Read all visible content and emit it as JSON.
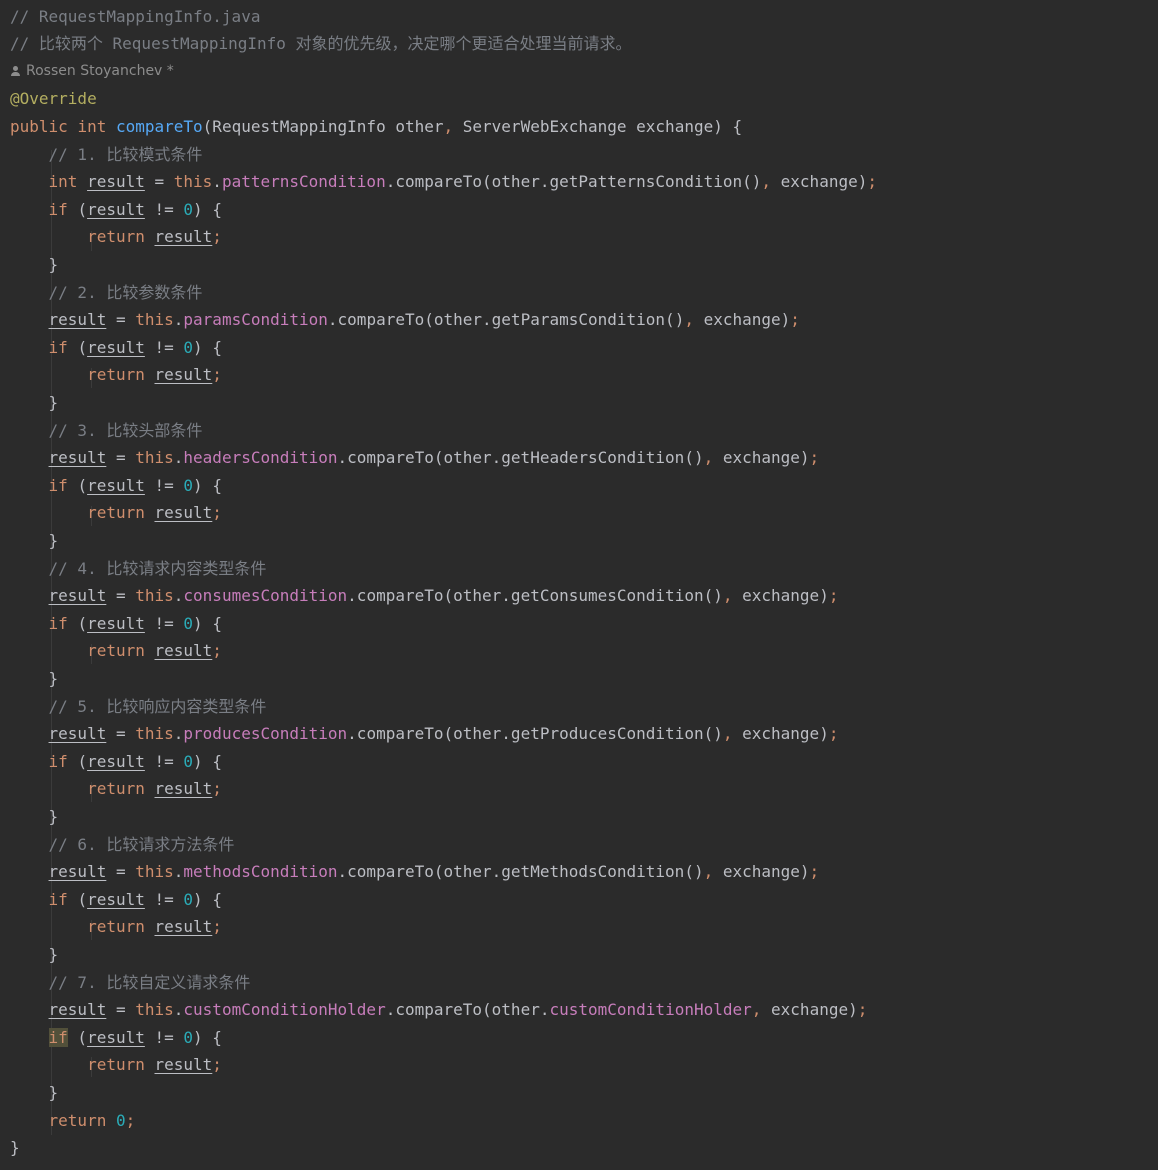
{
  "editor": {
    "author": {
      "icon": "user-icon",
      "text": "Rossen Stoyanchev *"
    },
    "lines": [
      [
        [
          "comment",
          "// RequestMappingInfo.java"
        ]
      ],
      [
        [
          "comment",
          "// 比较两个 RequestMappingInfo 对象的优先级，决定哪个更适合处理当前请求。"
        ]
      ],
      [],
      [
        [
          "annotation",
          "@Override"
        ]
      ],
      [
        [
          "keyword",
          "public "
        ],
        [
          "keyword",
          "int "
        ],
        [
          "method",
          "compareTo"
        ],
        [
          "plain",
          "(RequestMappingInfo other"
        ],
        [
          "punct",
          ", "
        ],
        [
          "plain",
          "ServerWebExchange exchange) {"
        ]
      ],
      [
        [
          "plain",
          "    "
        ],
        [
          "comment",
          "// 1. 比较模式条件"
        ]
      ],
      [
        [
          "plain",
          "    "
        ],
        [
          "keyword",
          "int "
        ],
        [
          "local",
          "result"
        ],
        [
          "plain",
          " = "
        ],
        [
          "keyword",
          "this"
        ],
        [
          "plain",
          "."
        ],
        [
          "field",
          "patternsCondition"
        ],
        [
          "plain",
          ".compareTo(other.getPatternsCondition()"
        ],
        [
          "punct",
          ", "
        ],
        [
          "plain",
          "exchange)"
        ],
        [
          "punct",
          ";"
        ]
      ],
      [
        [
          "plain",
          "    "
        ],
        [
          "keyword",
          "if "
        ],
        [
          "plain",
          "("
        ],
        [
          "local",
          "result"
        ],
        [
          "plain",
          " != "
        ],
        [
          "number",
          "0"
        ],
        [
          "plain",
          ") {"
        ]
      ],
      [
        [
          "plain",
          "        "
        ],
        [
          "keyword",
          "return "
        ],
        [
          "local",
          "result"
        ],
        [
          "punct",
          ";"
        ]
      ],
      [
        [
          "plain",
          "    }"
        ]
      ],
      [
        [
          "plain",
          "    "
        ],
        [
          "comment",
          "// 2. 比较参数条件"
        ]
      ],
      [
        [
          "plain",
          "    "
        ],
        [
          "local",
          "result"
        ],
        [
          "plain",
          " = "
        ],
        [
          "keyword",
          "this"
        ],
        [
          "plain",
          "."
        ],
        [
          "field",
          "paramsCondition"
        ],
        [
          "plain",
          ".compareTo(other.getParamsCondition()"
        ],
        [
          "punct",
          ", "
        ],
        [
          "plain",
          "exchange)"
        ],
        [
          "punct",
          ";"
        ]
      ],
      [
        [
          "plain",
          "    "
        ],
        [
          "keyword",
          "if "
        ],
        [
          "plain",
          "("
        ],
        [
          "local",
          "result"
        ],
        [
          "plain",
          " != "
        ],
        [
          "number",
          "0"
        ],
        [
          "plain",
          ") {"
        ]
      ],
      [
        [
          "plain",
          "        "
        ],
        [
          "keyword",
          "return "
        ],
        [
          "local",
          "result"
        ],
        [
          "punct",
          ";"
        ]
      ],
      [
        [
          "plain",
          "    }"
        ]
      ],
      [
        [
          "plain",
          "    "
        ],
        [
          "comment",
          "// 3. 比较头部条件"
        ]
      ],
      [
        [
          "plain",
          "    "
        ],
        [
          "local",
          "result"
        ],
        [
          "plain",
          " = "
        ],
        [
          "keyword",
          "this"
        ],
        [
          "plain",
          "."
        ],
        [
          "field",
          "headersCondition"
        ],
        [
          "plain",
          ".compareTo(other.getHeadersCondition()"
        ],
        [
          "punct",
          ", "
        ],
        [
          "plain",
          "exchange)"
        ],
        [
          "punct",
          ";"
        ]
      ],
      [
        [
          "plain",
          "    "
        ],
        [
          "keyword",
          "if "
        ],
        [
          "plain",
          "("
        ],
        [
          "local",
          "result"
        ],
        [
          "plain",
          " != "
        ],
        [
          "number",
          "0"
        ],
        [
          "plain",
          ") {"
        ]
      ],
      [
        [
          "plain",
          "        "
        ],
        [
          "keyword",
          "return "
        ],
        [
          "local",
          "result"
        ],
        [
          "punct",
          ";"
        ]
      ],
      [
        [
          "plain",
          "    }"
        ]
      ],
      [
        [
          "plain",
          "    "
        ],
        [
          "comment",
          "// 4. 比较请求内容类型条件"
        ]
      ],
      [
        [
          "plain",
          "    "
        ],
        [
          "local",
          "result"
        ],
        [
          "plain",
          " = "
        ],
        [
          "keyword",
          "this"
        ],
        [
          "plain",
          "."
        ],
        [
          "field",
          "consumesCondition"
        ],
        [
          "plain",
          ".compareTo(other.getConsumesCondition()"
        ],
        [
          "punct",
          ", "
        ],
        [
          "plain",
          "exchange)"
        ],
        [
          "punct",
          ";"
        ]
      ],
      [
        [
          "plain",
          "    "
        ],
        [
          "keyword",
          "if "
        ],
        [
          "plain",
          "("
        ],
        [
          "local",
          "result"
        ],
        [
          "plain",
          " != "
        ],
        [
          "number",
          "0"
        ],
        [
          "plain",
          ") {"
        ]
      ],
      [
        [
          "plain",
          "        "
        ],
        [
          "keyword",
          "return "
        ],
        [
          "local",
          "result"
        ],
        [
          "punct",
          ";"
        ]
      ],
      [
        [
          "plain",
          "    }"
        ]
      ],
      [
        [
          "plain",
          "    "
        ],
        [
          "comment",
          "// 5. 比较响应内容类型条件"
        ]
      ],
      [
        [
          "plain",
          "    "
        ],
        [
          "local",
          "result"
        ],
        [
          "plain",
          " = "
        ],
        [
          "keyword",
          "this"
        ],
        [
          "plain",
          "."
        ],
        [
          "field",
          "producesCondition"
        ],
        [
          "plain",
          ".compareTo(other.getProducesCondition()"
        ],
        [
          "punct",
          ", "
        ],
        [
          "plain",
          "exchange)"
        ],
        [
          "punct",
          ";"
        ]
      ],
      [
        [
          "plain",
          "    "
        ],
        [
          "keyword",
          "if "
        ],
        [
          "plain",
          "("
        ],
        [
          "local",
          "result"
        ],
        [
          "plain",
          " != "
        ],
        [
          "number",
          "0"
        ],
        [
          "plain",
          ") {"
        ]
      ],
      [
        [
          "plain",
          "        "
        ],
        [
          "keyword",
          "return "
        ],
        [
          "local",
          "result"
        ],
        [
          "punct",
          ";"
        ]
      ],
      [
        [
          "plain",
          "    }"
        ]
      ],
      [
        [
          "plain",
          "    "
        ],
        [
          "comment",
          "// 6. 比较请求方法条件"
        ]
      ],
      [
        [
          "plain",
          "    "
        ],
        [
          "local",
          "result"
        ],
        [
          "plain",
          " = "
        ],
        [
          "keyword",
          "this"
        ],
        [
          "plain",
          "."
        ],
        [
          "field",
          "methodsCondition"
        ],
        [
          "plain",
          ".compareTo(other.getMethodsCondition()"
        ],
        [
          "punct",
          ", "
        ],
        [
          "plain",
          "exchange)"
        ],
        [
          "punct",
          ";"
        ]
      ],
      [
        [
          "plain",
          "    "
        ],
        [
          "keyword",
          "if "
        ],
        [
          "plain",
          "("
        ],
        [
          "local",
          "result"
        ],
        [
          "plain",
          " != "
        ],
        [
          "number",
          "0"
        ],
        [
          "plain",
          ") {"
        ]
      ],
      [
        [
          "plain",
          "        "
        ],
        [
          "keyword",
          "return "
        ],
        [
          "local",
          "result"
        ],
        [
          "punct",
          ";"
        ]
      ],
      [
        [
          "plain",
          "    }"
        ]
      ],
      [
        [
          "plain",
          "    "
        ],
        [
          "comment",
          "// 7. 比较自定义请求条件"
        ]
      ],
      [
        [
          "plain",
          "    "
        ],
        [
          "local",
          "result"
        ],
        [
          "plain",
          " = "
        ],
        [
          "keyword",
          "this"
        ],
        [
          "plain",
          "."
        ],
        [
          "field",
          "customConditionHolder"
        ],
        [
          "plain",
          ".compareTo(other."
        ],
        [
          "field",
          "customConditionHolder"
        ],
        [
          "punct",
          ", "
        ],
        [
          "plain",
          "exchange)"
        ],
        [
          "punct",
          ";"
        ]
      ],
      [
        [
          "plain",
          "    "
        ],
        [
          "keyword hl",
          "if"
        ],
        [
          "plain",
          " ("
        ],
        [
          "local",
          "result"
        ],
        [
          "plain",
          " != "
        ],
        [
          "number",
          "0"
        ],
        [
          "plain",
          ") {"
        ]
      ],
      [
        [
          "plain",
          "        "
        ],
        [
          "keyword",
          "return "
        ],
        [
          "local",
          "result"
        ],
        [
          "punct",
          ";"
        ]
      ],
      [
        [
          "plain",
          "    }"
        ]
      ],
      [
        [
          "plain",
          "    "
        ],
        [
          "keyword",
          "return "
        ],
        [
          "number",
          "0"
        ],
        [
          "punct",
          ";"
        ]
      ],
      [
        [
          "plain",
          "}"
        ]
      ]
    ]
  },
  "colors": {
    "background": "#2b2b2b",
    "comment": "#7a7e85",
    "keyword": "#cf8e6d",
    "annotation": "#b3ae60",
    "method": "#56a8f5",
    "field": "#c77dbb",
    "number": "#2aacb8",
    "text": "#bcbec4"
  }
}
